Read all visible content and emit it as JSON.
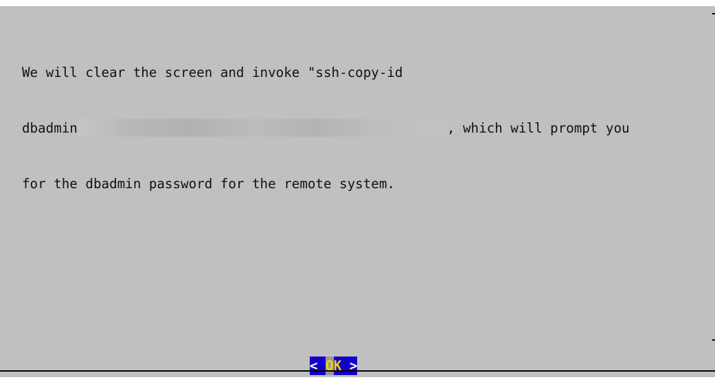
{
  "dialog": {
    "message": {
      "line1": "We will clear the screen and invoke \"ssh-copy-id",
      "line2_prefix": "dbadmin",
      "line2_suffix": ", which will prompt you",
      "line3": "for the dbadmin password for the remote system."
    },
    "button": {
      "left_bracket": "<",
      "label_first": "O",
      "label_rest": "K",
      "right_bracket": ">"
    }
  },
  "colors": {
    "dialog_background": "#c0c0c0",
    "button_background": "#1400c8",
    "button_text": "#ffffff",
    "hotkey_text": "#f0d400",
    "cursor_cell": "#9a9a9a"
  }
}
